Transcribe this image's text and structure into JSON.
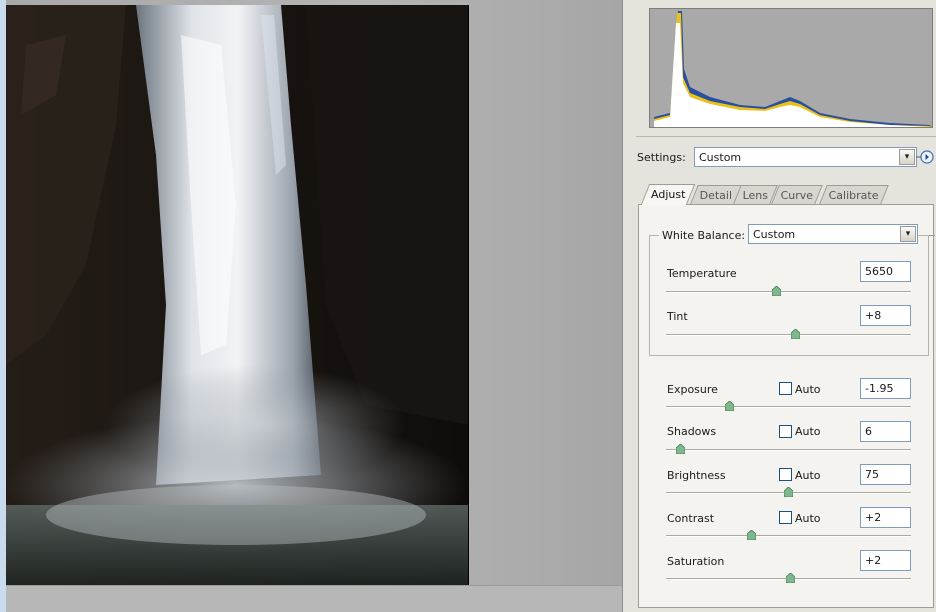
{
  "settings": {
    "label": "Settings:",
    "value": "Custom"
  },
  "tabs": [
    {
      "label": "Adjust",
      "active": true
    },
    {
      "label": "Detail",
      "active": false
    },
    {
      "label": "Lens",
      "active": false
    },
    {
      "label": "Curve",
      "active": false
    },
    {
      "label": "Calibrate",
      "active": false
    }
  ],
  "white_balance": {
    "label": "White Balance:",
    "value": "Custom"
  },
  "temperature": {
    "label": "Temperature",
    "value": "5650",
    "level": 0.45
  },
  "tint": {
    "label": "Tint",
    "value": "+8",
    "level": 0.53
  },
  "exposure": {
    "label": "Exposure",
    "auto_label": "Auto",
    "value": "-1.95",
    "level": 0.26
  },
  "shadows": {
    "label": "Shadows",
    "auto_label": "Auto",
    "value": "6",
    "level": 0.06
  },
  "brightness": {
    "label": "Brightness",
    "auto_label": "Auto",
    "value": "75",
    "level": 0.5
  },
  "contrast": {
    "label": "Contrast",
    "auto_label": "Auto",
    "value": "+2",
    "level": 0.35
  },
  "saturation": {
    "label": "Saturation",
    "value": "+2",
    "level": 0.51
  },
  "colors": {
    "panel": "#e4e3dc",
    "preview_bg": "#b0b0b0",
    "histogram_bg": "#a9a9a9",
    "slider_thumb": "#7fb88c",
    "field_border": "#7f9db9"
  },
  "icons": {
    "settings_menu": "circle-arrow-right-icon",
    "dropdown": "chevron-down-icon"
  }
}
